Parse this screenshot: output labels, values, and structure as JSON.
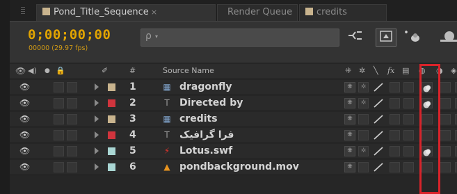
{
  "tabs": [
    {
      "label": "Pond_Title_Sequence",
      "swatch": "#c9b48e",
      "active": true,
      "close": "×"
    },
    {
      "label": "Render Queue",
      "active": false
    },
    {
      "label": "credits",
      "swatch": "#c9b48e",
      "active": false
    }
  ],
  "header": {
    "timecode": "0;00;00;00",
    "fps": "00000 (29.97 fps)",
    "search_glyph": "ρ",
    "search_caret": "▾"
  },
  "columns": {
    "number": "#",
    "source_name": "Source Name"
  },
  "layers": [
    {
      "num": "1",
      "name": "dragonfly",
      "label_color": "#c9b48e",
      "type": "footage",
      "has_collapse": true
    },
    {
      "num": "2",
      "name": "Directed by",
      "label_color": "#d0343d",
      "type": "text",
      "has_collapse": true
    },
    {
      "num": "3",
      "name": "credits",
      "label_color": "#c9b48e",
      "type": "footage",
      "has_collapse": false
    },
    {
      "num": "4",
      "name": "فرا گرافیک",
      "label_color": "#d0343d",
      "type": "text",
      "has_collapse": false
    },
    {
      "num": "5",
      "name": "Lotus.swf",
      "label_color": "#a9d6d3",
      "type": "swf",
      "has_collapse": true
    },
    {
      "num": "6",
      "name": "pondbackground.mov",
      "label_color": "#a9d6d3",
      "type": "movie",
      "has_collapse": false
    }
  ],
  "colors": {
    "timecode": "#e2a400",
    "highlight": "#d8232a",
    "panel": "#2a2a2a"
  }
}
